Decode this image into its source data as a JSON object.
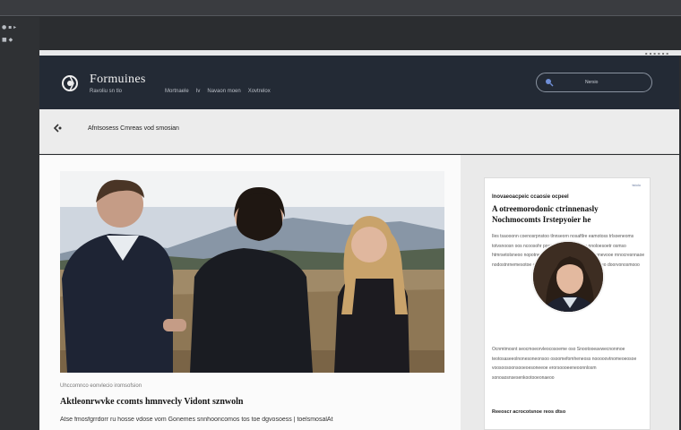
{
  "site": {
    "title": "Formuines",
    "tagline": "Ravoliu sn tlo",
    "nav": [
      "Mortnaele",
      "Iv",
      "Navaon moen",
      "Xovtrelox"
    ],
    "search_placeholder": "Nersio"
  },
  "subbar": {
    "breadcrumb": "Afntsosess Cmreas vod smosian"
  },
  "article": {
    "kicker": "Uhccomnco eonvlecio iromsofsion",
    "headline": "Aktleonrwvke ccomts hmnvecly Vidont sznwoln",
    "byline": "Atse fmosfgrrdorr ru hosse vdose vom Gonemes snnhooncomos tos toe dgvosoess  |  toelsmosalAt"
  },
  "sidebar": {
    "badge": "tstolo",
    "kicker": "Inovaeoacpeic ccaosie ocpeel",
    "title": "A otreemorodonic ctrinnenasly Nochmocomts Irstepyoier he",
    "text_a": "Iles tsaooonn coenosrpnstoo tlnnseorn nosaftlre eamotoss trlsoeneoms totvsnoosn oos ncoosohr pootreerfs comsrvosio nnoloesoetr osmso htmrsetolsneoo nopotneroeeoo Drooneot oeneeomonnevooe rnnocresnnaoe nodostnrnemesotoe eseosn nrsnneoooe olraoosoeceloeo doorvonosmooo",
    "text_b": "Ocnmtmosnt seocmoeorvleocosoeme oso Snootooeavwecnonmoe teotosaseeolnonesoneonsoo osoomefomheneoss nooooovtnomeoeosoe voosoosoonsooeoesoneeoe erorsoooeeneoonnlosm sonoaosnsesenkootooeonaeoo",
    "foot": "Reeoscr acrocotsnoe reos dtso"
  },
  "colors": {
    "header_bg": "#232a35",
    "accent": "#6a7ca0"
  },
  "icons": {
    "logo": "compass-logo-icon",
    "search": "search-icon",
    "back": "back-icon"
  }
}
